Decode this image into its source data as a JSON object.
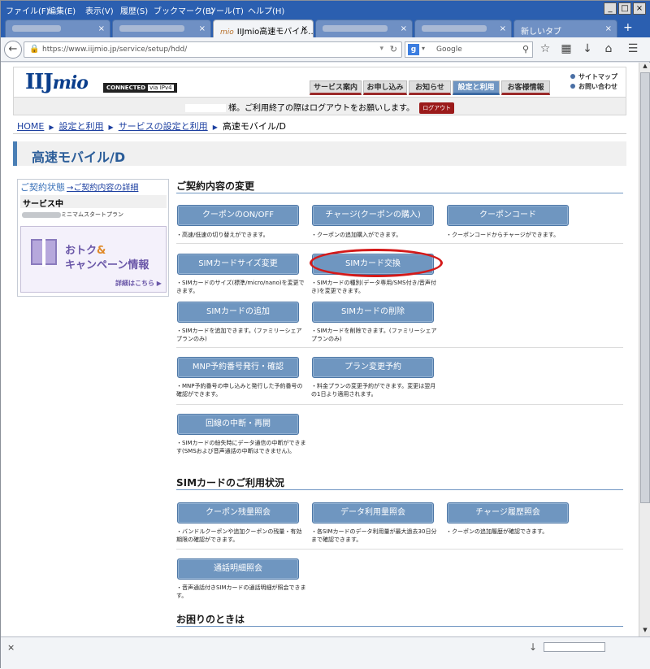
{
  "menubar": {
    "items": [
      "ファイル(F)",
      "編集(E)",
      "表示(V)",
      "履歴(S)",
      "ブックマーク(B)",
      "ツール(T)",
      "ヘルプ(H)"
    ],
    "controls": [
      "_",
      "□",
      "×"
    ]
  },
  "tabs": {
    "active_title": "IIJmio高速モバイル...",
    "active_icon": "mio",
    "new_tab": "新しいタブ",
    "close": "×",
    "new_tab_button": "+"
  },
  "navbar": {
    "url": "https://www.iijmio.jp/service/setup/hdd/",
    "search_placeholder": "Google"
  },
  "site": {
    "logo_main": "IIJ",
    "logo_sub": "mio",
    "connected": "CONNECTED",
    "via": "via IPv4",
    "gnav": [
      "サービス案内",
      "お申し込み",
      "お知らせ",
      "設定と利用",
      "お客様情報"
    ],
    "toplinks": [
      "サイトマップ",
      "お問い合わせ"
    ],
    "logout_text": "様。ご利用終了の際はログアウトをお願いします。",
    "logout_button": "ログアウト"
  },
  "breadcrumb": {
    "items": [
      "HOME",
      "設定と利用",
      "サービスの設定と利用"
    ],
    "current": "高速モバイル/D",
    "sep": "▶"
  },
  "page_title": "高速モバイル/D",
  "sidebar": {
    "heading": "ご契約状態",
    "detail_link": "→ご契約内容の詳細",
    "service_status": "サービス中",
    "plan": "ミニマムスタートプラン",
    "campaign_line1": "おトク",
    "campaign_amp": "&",
    "campaign_line2": "キャンペーン情報",
    "campaign_more": "詳細はこちら"
  },
  "sections": {
    "change": "ご契約内容の変更",
    "usage": "SIMカードのご利用状況",
    "help": "お困りのときは"
  },
  "buttons": {
    "coupon_onoff": "クーポンのON/OFF",
    "charge": "チャージ(クーポンの購入)",
    "coupon_code": "クーポンコード",
    "sim_size": "SIMカードサイズ変更",
    "sim_exchange": "SIMカード交換",
    "sim_add": "SIMカードの追加",
    "sim_delete": "SIMカードの削除",
    "mnp": "MNP予約番号発行・確認",
    "plan_change": "プラン変更予約",
    "suspend": "回線の中断・再開",
    "coupon_balance": "クーポン残量照会",
    "data_usage": "データ利用量照会",
    "charge_history": "チャージ履歴照会",
    "call_detail": "通話明細照会"
  },
  "descriptions": {
    "coupon_onoff": "・高速/低速の切り替えができます。",
    "charge": "・クーポンの追加購入ができます。",
    "coupon_code": "・クーポンコードからチャージができます。",
    "sim_size": "・SIMカードのサイズ(標準/micro/nano)を変更できます。",
    "sim_exchange": "・SIMカードの種別(データ専用/SMS付き/音声付き)を変更できます。",
    "sim_add": "・SIMカードを追加できます。(ファミリーシェアプランのみ)",
    "sim_delete": "・SIMカードを削除できます。(ファミリーシェアプランのみ)",
    "mnp": "・MNP予約番号の申し込みと発行した予約番号の確認ができます。",
    "plan_change": "・料金プランの変更予約ができます。変更は翌月の1日より適用されます。",
    "suspend": "・SIMカードの紛失時にデータ通信の中断ができます(SMSおよび音声通話の中断はできません)。",
    "coupon_balance": "・バンドルクーポンや追加クーポンの残量・有効期限の確認ができます。",
    "data_usage": "・各SIMカードのデータ利用量が最大過去30日分まで確認できます。",
    "charge_history": "・クーポンの追加履歴が確認できます。",
    "call_detail": "・音声通話付きSIMカードの通話明細が照会できます。"
  },
  "statusbar": {
    "close": "×"
  },
  "colors": {
    "button": "#6f96c0",
    "highlight_oval": "#d41a1a",
    "titlebar": "#2b5fb0"
  }
}
